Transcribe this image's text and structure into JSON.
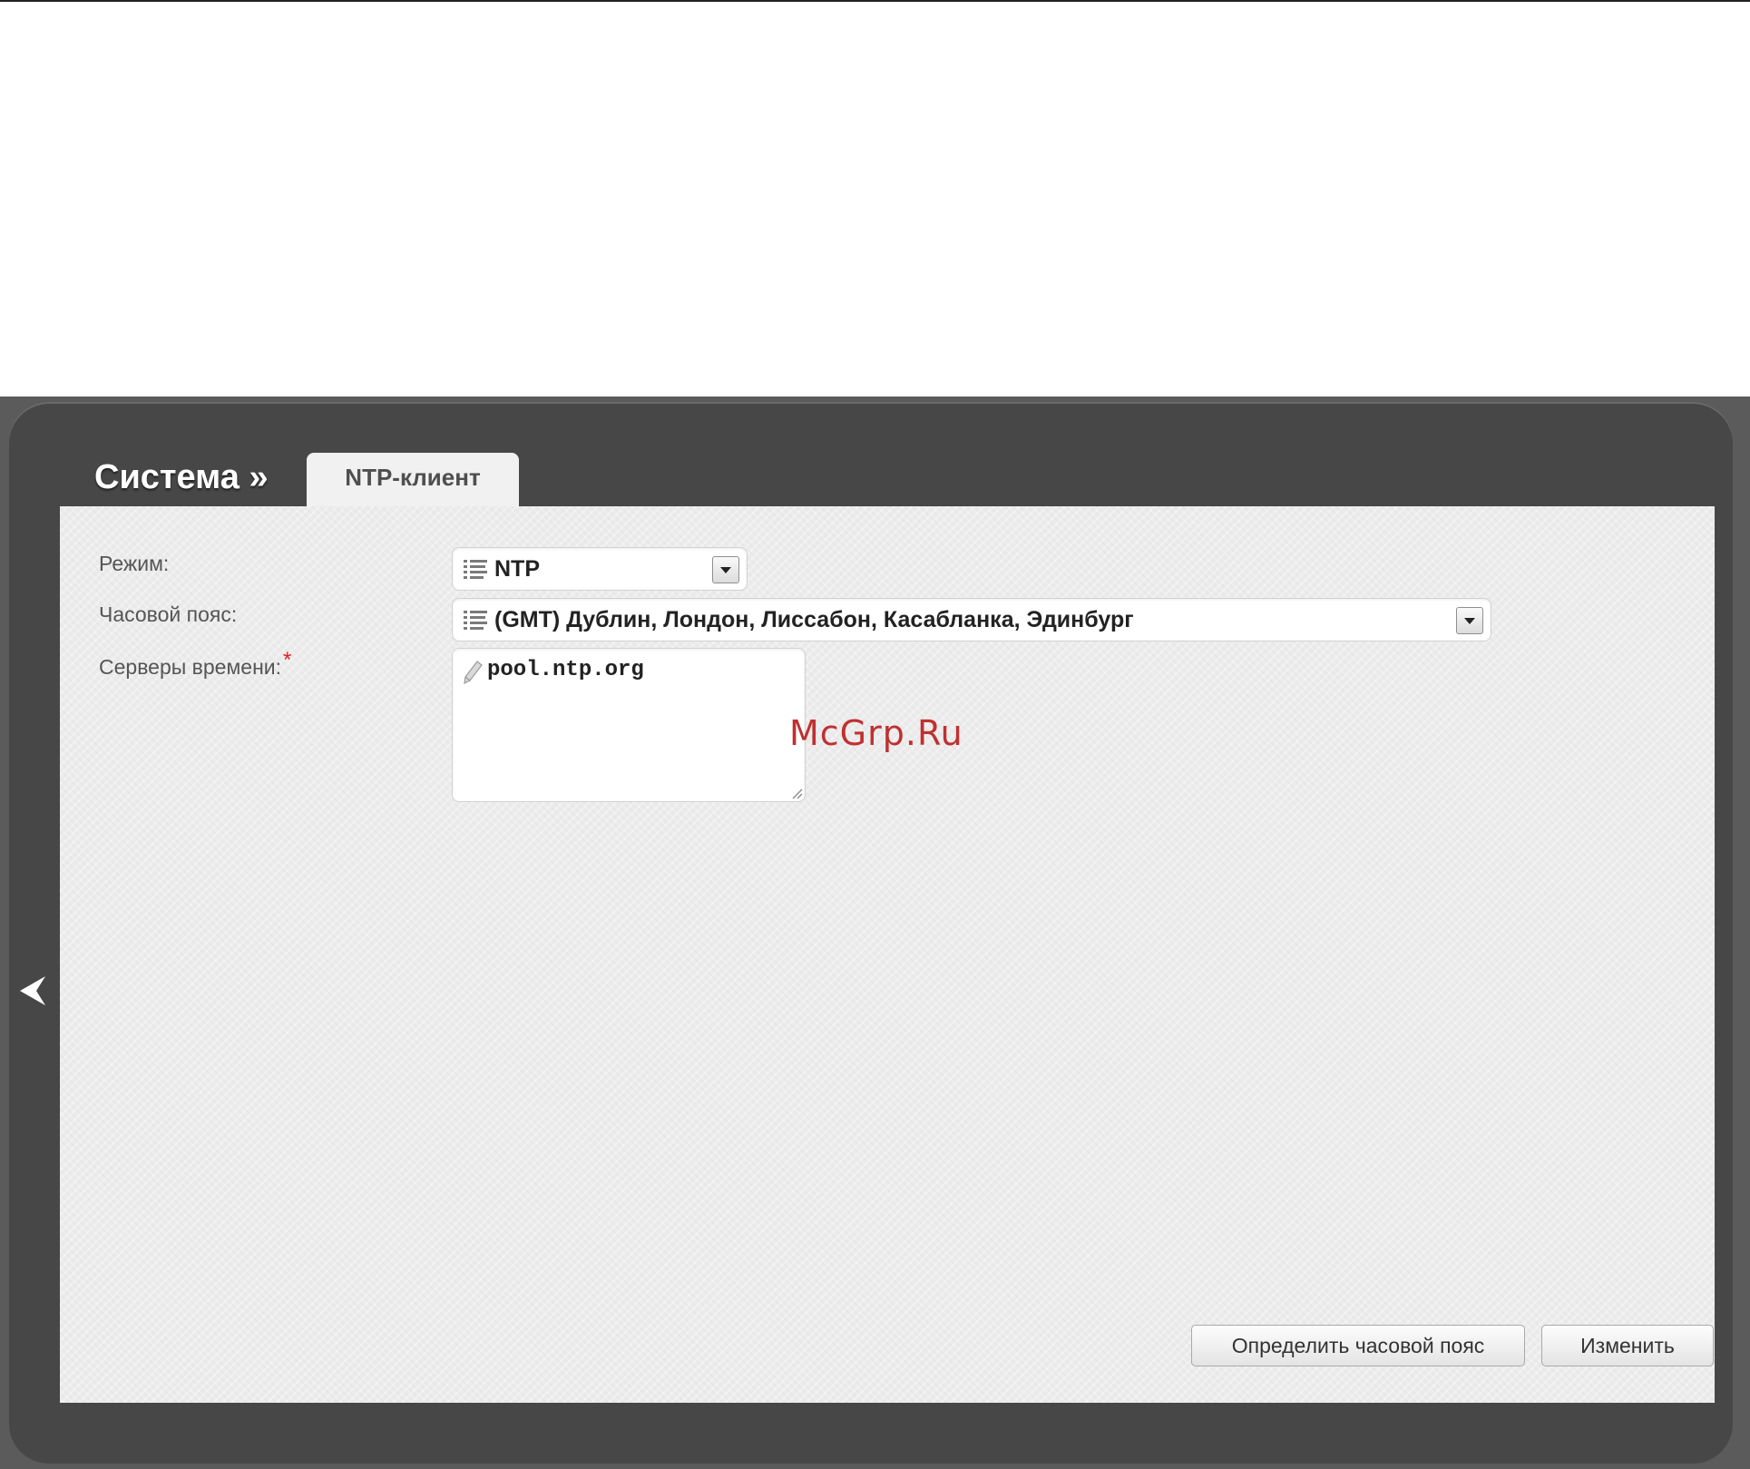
{
  "breadcrumb": {
    "section": "Система »",
    "tab_label": "NTP-клиент"
  },
  "form": {
    "mode": {
      "label": "Режим:",
      "value": "NTP",
      "icon": "list-icon"
    },
    "timezone": {
      "label": "Часовой пояс:",
      "value": "(GMT) Дублин, Лондон, Лиссабон, Касабланка, Эдинбург",
      "icon": "list-icon"
    },
    "servers": {
      "label": "Серверы времени:",
      "required_mark": "*",
      "value": "pool.ntp.org",
      "icon": "pencil-icon"
    }
  },
  "buttons": {
    "detect_timezone": "Определить часовой пояс",
    "apply": "Изменить"
  },
  "watermark": "McGrp.Ru",
  "colors": {
    "frame": "#474747",
    "content": "#ececec",
    "required": "#e02020",
    "watermark": "#c03030"
  }
}
